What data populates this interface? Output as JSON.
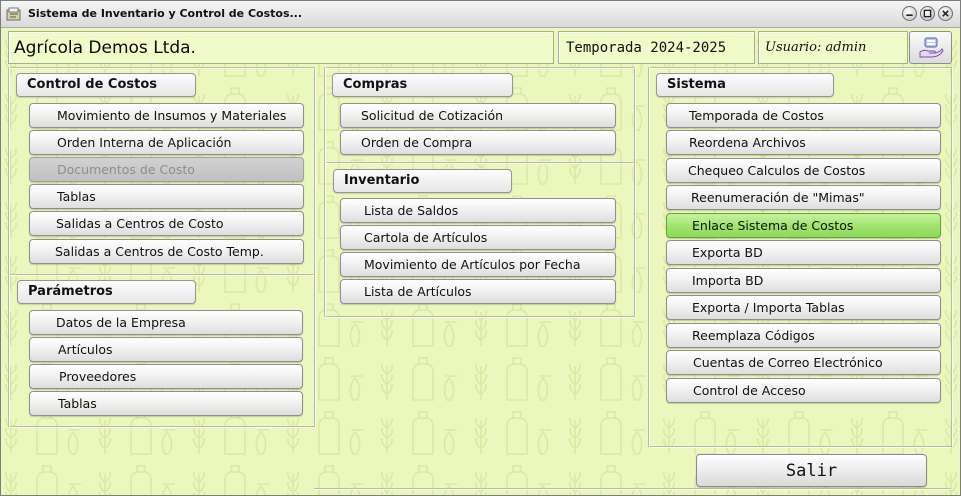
{
  "window": {
    "title": "Sistema de Inventario y Control de Costos..."
  },
  "header": {
    "company": "Agrícola Demos Ltda.",
    "season": "Temporada 2024-2025",
    "user": "Usuario: admin"
  },
  "control_costos": {
    "label": "Control de Costos",
    "items": [
      {
        "label": "Movimiento de Insumos y Materiales",
        "enabled": true
      },
      {
        "label": "Orden Interna de Aplicación",
        "enabled": true
      },
      {
        "label": "Documentos de Costo",
        "enabled": false
      },
      {
        "label": "Tablas",
        "enabled": true
      },
      {
        "label": "Salidas a Centros de Costo",
        "enabled": true
      },
      {
        "label": "Salidas a Centros de Costo Temp.",
        "enabled": true
      }
    ]
  },
  "parametros": {
    "label": "Parámetros",
    "items": [
      {
        "label": "Datos de la Empresa"
      },
      {
        "label": "Artículos"
      },
      {
        "label": "Proveedores"
      },
      {
        "label": "Tablas"
      }
    ]
  },
  "compras": {
    "label": "Compras",
    "items": [
      {
        "label": "Solicitud de Cotización"
      },
      {
        "label": "Orden de Compra"
      }
    ]
  },
  "inventario": {
    "label": "Inventario",
    "items": [
      {
        "label": "Lista de Saldos"
      },
      {
        "label": "Cartola de Artículos"
      },
      {
        "label": "Movimiento de Artículos por Fecha"
      },
      {
        "label": "Lista de Artículos"
      }
    ]
  },
  "sistema": {
    "label": "Sistema",
    "items": [
      {
        "label": "Temporada de Costos"
      },
      {
        "label": "Reordena Archivos"
      },
      {
        "label": "Chequeo Calculos de Costos"
      },
      {
        "label": "Reenumeración de \"Mimas\""
      },
      {
        "label": "Enlace Sistema de Costos",
        "highlighted": true
      },
      {
        "label": "Exporta BD"
      },
      {
        "label": "Importa BD"
      },
      {
        "label": "Exporta / Importa Tablas"
      },
      {
        "label": "Reemplaza Códigos"
      },
      {
        "label": "Cuentas de Correo Electrónico"
      },
      {
        "label": "Control de Acceso"
      }
    ]
  },
  "footer": {
    "exit_label": "Salir"
  },
  "colors": {
    "background": "#ecf7bd",
    "highlight": "#9ee36d",
    "disabled_text": "#8e8e8e"
  },
  "icons": {
    "app": "folder-app-icon",
    "user": "user-tray-icon",
    "minimize": "minimize-icon",
    "maximize": "maximize-icon",
    "close": "close-icon"
  }
}
